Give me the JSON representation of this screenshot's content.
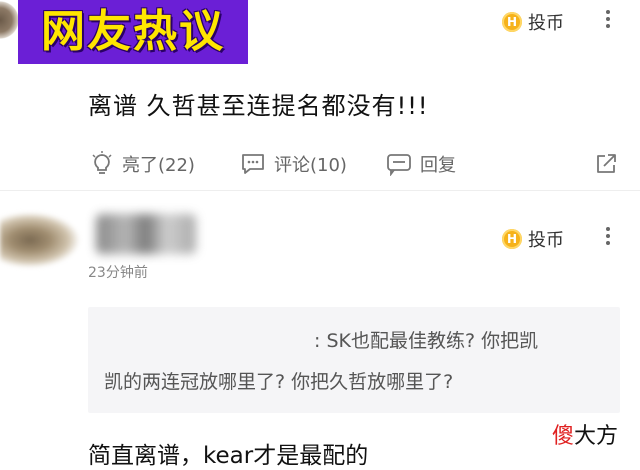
{
  "banner": {
    "title": "网友热议"
  },
  "coin_label": "投币",
  "comment1": {
    "text": "离谱 久哲甚至连提名都没有!!!",
    "likes": "亮了(22)",
    "comments": "评论(10)",
    "reply": "回复"
  },
  "comment2": {
    "time": "23分钟前",
    "quote_line1": ": SK也配最佳教练? 你把凯",
    "quote_line2": "凯的两连冠放哪里了? 你把久哲放哪里了?",
    "text": "简直离谱，kear才是最配的"
  },
  "watermark": {
    "first_char": "傻",
    "rest": "大方"
  },
  "colors": {
    "banner_bg": "#6b1fd6",
    "banner_text": "#ffe600",
    "coin": "#f6b21a",
    "watermark_accent": "#e02020"
  },
  "icons": [
    "coin-icon",
    "more-icon",
    "lightbulb-icon",
    "comment-icon",
    "reply-icon",
    "share-icon"
  ]
}
